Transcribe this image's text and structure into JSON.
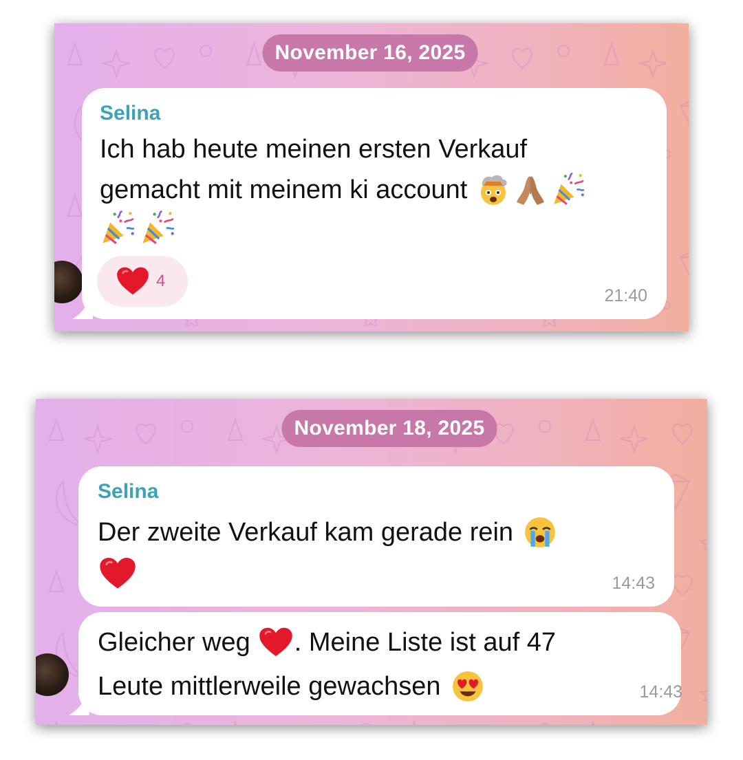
{
  "colors": {
    "accent_name": "#3ba2b8",
    "date_pill": "#c778a8",
    "reaction_count": "#d64f85",
    "time": "#9a9a9a",
    "heart": "#e3192b"
  },
  "screens": [
    {
      "date": "November 16, 2025",
      "message": {
        "sender": "Selina",
        "lines": [
          "Ich hab heute meinen ersten Verkauf",
          "gemacht mit meinem ki account"
        ],
        "emojis_line2": [
          "exploding-head-emoji",
          "praying-hands-emoji",
          "party-popper-emoji"
        ],
        "emojis_line3": [
          "party-popper-emoji",
          "party-popper-emoji"
        ],
        "reaction": {
          "icon": "heart-icon",
          "count": "4"
        },
        "time": "21:40"
      }
    },
    {
      "date": "November 18, 2025",
      "message1": {
        "sender": "Selina",
        "line1": "Der zweite Verkauf kam gerade rein",
        "emoji_line1": "loudly-crying-emoji",
        "emoji_line2": "red-heart-emoji",
        "time": "14:43"
      },
      "message2": {
        "line1_a": "Gleicher weg",
        "line1_emoji": "red-heart-emoji",
        "line1_b": ". Meine Liste ist auf 47",
        "line2": "Leute mittlerweile gewachsen",
        "line2_emoji": "heart-eyes-emoji",
        "time": "14:43"
      }
    }
  ]
}
